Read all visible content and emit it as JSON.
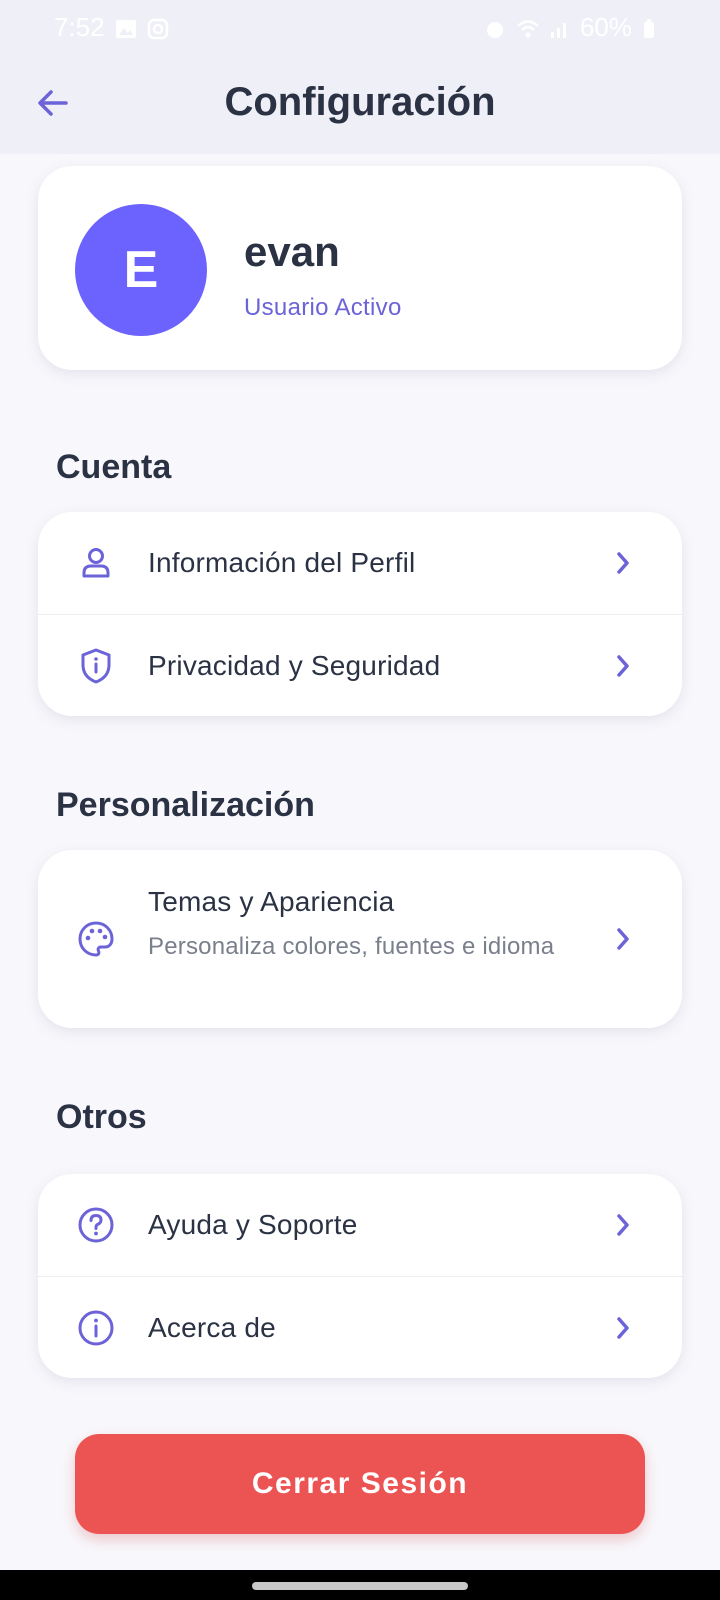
{
  "status_bar": {
    "time": "7:52",
    "battery": "60%",
    "icons": [
      "image-icon",
      "instagram-icon",
      "alarm-icon",
      "wifi-icon",
      "signal-icon",
      "battery-icon"
    ]
  },
  "header": {
    "title": "Configuración",
    "back_icon": "arrow-left-icon"
  },
  "profile": {
    "initial": "E",
    "name": "evan",
    "status": "Usuario Activo"
  },
  "sections": [
    {
      "title": "Cuenta",
      "items": [
        {
          "label": "Información del Perfil",
          "icon": "user-icon"
        },
        {
          "label": "Privacidad y Seguridad",
          "icon": "shield-icon"
        }
      ]
    },
    {
      "title": "Personalización",
      "items": [
        {
          "label": "Temas y Apariencia",
          "sublabel": "Personaliza colores, fuentes e idioma",
          "icon": "palette-icon"
        }
      ]
    },
    {
      "title": "Otros",
      "items": [
        {
          "label": "Ayuda y Soporte",
          "icon": "help-circle-icon"
        },
        {
          "label": "Acerca de",
          "icon": "info-circle-icon"
        }
      ]
    }
  ],
  "logout": {
    "label": "Cerrar Sesión"
  },
  "colors": {
    "accent": "#6c63ff",
    "danger": "#ec5454",
    "text": "#2a3244",
    "header_bg": "#efeff7"
  }
}
